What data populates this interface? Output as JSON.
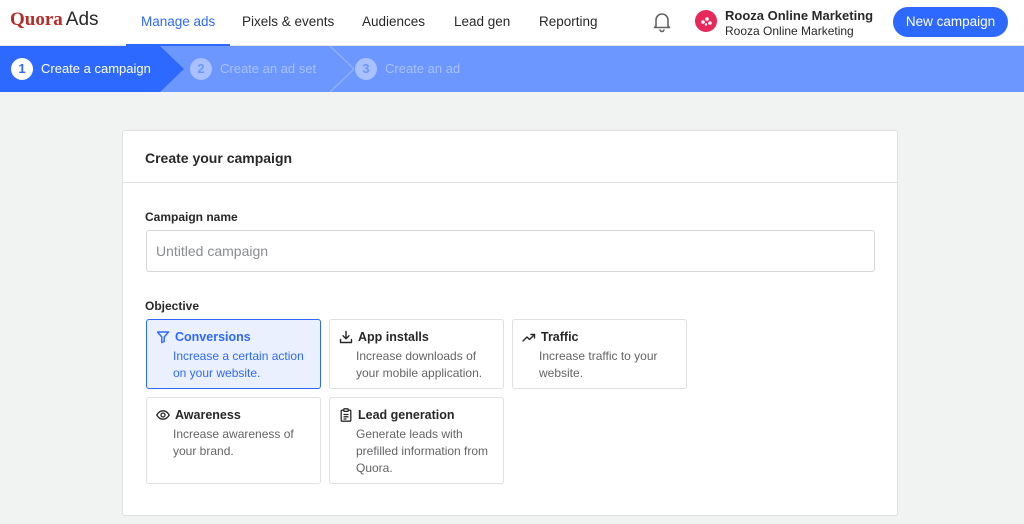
{
  "topbar": {
    "brand": "Quora",
    "product": "Ads",
    "nav": [
      "Manage ads",
      "Pixels & events",
      "Audiences",
      "Lead gen",
      "Reporting"
    ],
    "account_name": "Rooza Online Marketing",
    "account_sub": "Rooza Online Marketing",
    "new_campaign": "New campaign"
  },
  "steps": [
    {
      "num": "1",
      "label": "Create a campaign"
    },
    {
      "num": "2",
      "label": "Create an ad set"
    },
    {
      "num": "3",
      "label": "Create an ad"
    }
  ],
  "card": {
    "title": "Create your campaign",
    "name_label": "Campaign name",
    "name_placeholder": "Untitled campaign",
    "name_value": "",
    "objective_label": "Objective",
    "objectives": [
      {
        "icon": "filter-icon",
        "title": "Conversions",
        "desc": "Increase a certain action on your website.",
        "selected": true
      },
      {
        "icon": "download-icon",
        "title": "App installs",
        "desc": "Increase downloads of your mobile application.",
        "selected": false
      },
      {
        "icon": "trending-up-icon",
        "title": "Traffic",
        "desc": "Increase traffic to your website.",
        "selected": false
      },
      {
        "icon": "eye-icon",
        "title": "Awareness",
        "desc": "Increase awareness of your brand.",
        "selected": false
      },
      {
        "icon": "clipboard-icon",
        "title": "Lead generation",
        "desc": "Generate leads with prefilled information from Quora.",
        "selected": false
      }
    ]
  },
  "colors": {
    "accent": "#2e69ff",
    "brand_red": "#b92b27",
    "stepbar_inactive": "#6c97ff",
    "avatar": "#e8285b"
  }
}
